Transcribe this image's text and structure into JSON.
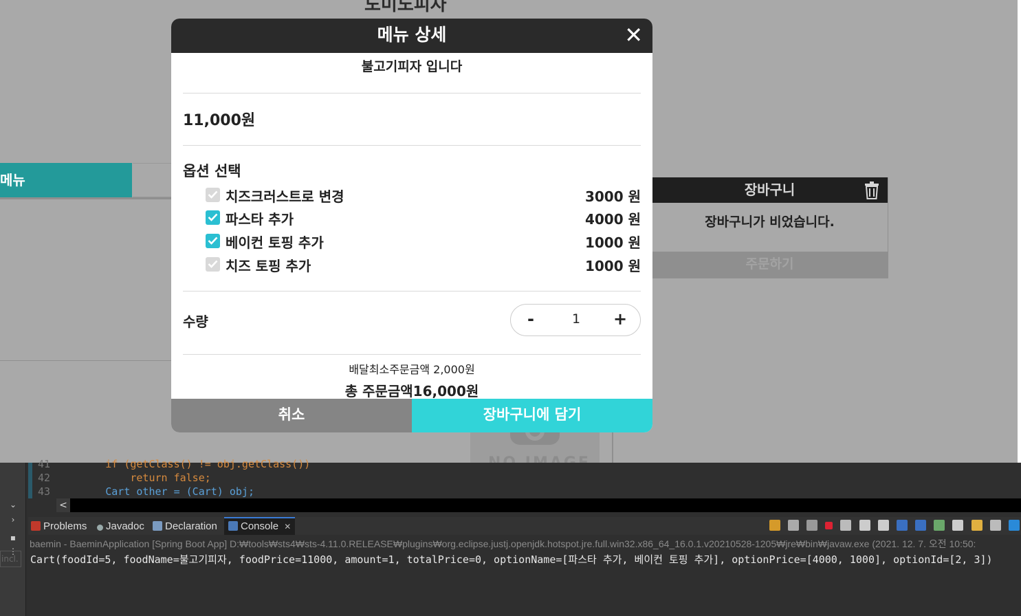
{
  "web": {
    "store_title": "도미노피자",
    "menu_tab_label": "메뉴",
    "no_image_text": "NO IMAGE",
    "cart": {
      "title": "장바구니",
      "empty_message": "장바구니가 비었습니다.",
      "order_button": "주문하기"
    }
  },
  "modal": {
    "title": "메뉴 상세",
    "close_glyph": "✕",
    "description": "불고기피자 입니다",
    "price": "11,000원",
    "options_title": "옵션 선택",
    "options": [
      {
        "name": "치즈크러스트로 변경",
        "price": "3000 원",
        "checked": false
      },
      {
        "name": "파스타 추가",
        "price": "4000 원",
        "checked": true
      },
      {
        "name": "베이컨 토핑 추가",
        "price": "1000 원",
        "checked": true
      },
      {
        "name": "치즈 토핑 추가",
        "price": "1000 원",
        "checked": false
      }
    ],
    "quantity_label": "수량",
    "quantity_minus": "-",
    "quantity_value": "1",
    "quantity_plus": "+",
    "min_order": "배달최소주문금액 2,000원",
    "total": "총 주문금액16,000원",
    "cancel_button": "취소",
    "add_to_cart_button": "장바구니에 담기"
  },
  "ide": {
    "code_lines": [
      {
        "num": "41",
        "text": "        if (getClass() != obj.getClass())"
      },
      {
        "num": "42",
        "text": "            return false;"
      },
      {
        "num": "43",
        "text": "        Cart other = (Cart) obj;"
      }
    ],
    "scroll_left_glyph": "<",
    "tabs": [
      {
        "label": "Problems"
      },
      {
        "label": "Javadoc"
      },
      {
        "label": "Declaration"
      },
      {
        "label": "Console"
      }
    ],
    "tab_close_glyph": "✕",
    "console_path": "baemin - BaeminApplication [Spring Boot App] D:₩tools₩sts4₩sts-4.11.0.RELEASE₩plugins₩org.eclipse.justj.openjdk.hotspot.jre.full.win32.x86_64_16.0.1.v20210528-1205₩jre₩bin₩javaw.exe  (2021. 12. 7. 오전 10:50:",
    "console_output": "Cart(foodId=5, foodName=불고기피자, foodPrice=11000, amount=1, totalPrice=0, optionName=[파스타 추가, 베이컨 토핑 추가], optionPrice=[4000, 1000], optionId=[2, 3])",
    "filter_placeholder": "incl.",
    "colors": {
      "accent": "#31d4d8",
      "menu_tab": "#239a9a"
    }
  }
}
